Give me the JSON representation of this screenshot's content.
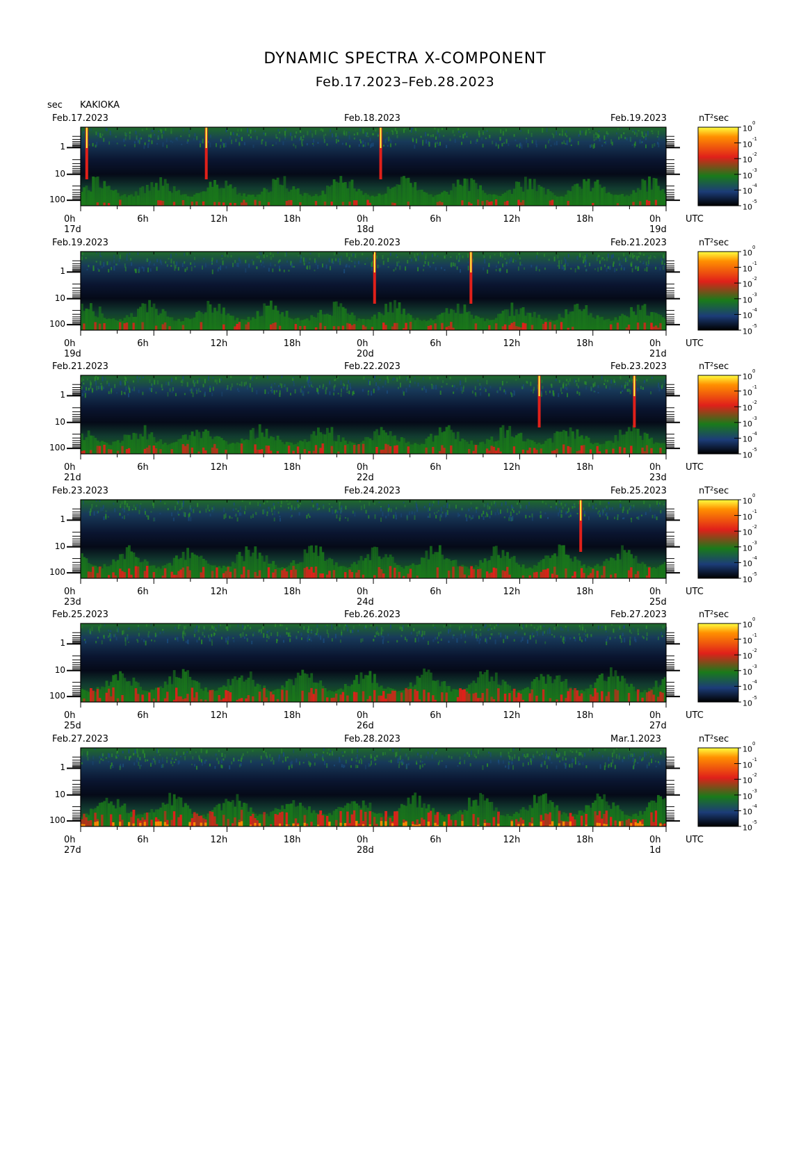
{
  "title": "DYNAMIC SPECTRA X-COMPONENT",
  "subtitle": "Feb.17.2023–Feb.28.2023",
  "y_unit": "sec",
  "station": "KAKIOKA",
  "colorbar_unit": "nT²sec",
  "colors": {
    "black": "#000000",
    "navy": "#0a1a4a",
    "blue": "#1c3c78",
    "green": "#1a7a1a",
    "red": "#e0201a",
    "orange": "#ff9000",
    "yellow": "#ffff40"
  },
  "chart_data": [
    {
      "type": "heatmap",
      "date_left": "Feb.17.2023",
      "date_mid": "Feb.18.2023",
      "date_right": "Feb.19.2023",
      "x_ticks": [
        "0h",
        "6h",
        "12h",
        "18h",
        "0h",
        "6h",
        "12h",
        "18h",
        "0h"
      ],
      "x_day_labels": [
        "17d",
        "18d",
        "19d"
      ],
      "x_unit": "UTC",
      "y_ticks": [
        "1",
        "10",
        "100"
      ],
      "y_scale": "log",
      "colorbar_ticks": [
        "10^0",
        "10^-1",
        "10^-2",
        "10^-3",
        "10^-4",
        "10^-5"
      ],
      "spikes_hours": [
        0.5,
        10.3,
        24.6
      ]
    },
    {
      "type": "heatmap",
      "date_left": "Feb.19.2023",
      "date_mid": "Feb.20.2023",
      "date_right": "Feb.21.2023",
      "x_ticks": [
        "0h",
        "6h",
        "12h",
        "18h",
        "0h",
        "6h",
        "12h",
        "18h",
        "0h"
      ],
      "x_day_labels": [
        "19d",
        "20d",
        "21d"
      ],
      "x_unit": "UTC",
      "y_ticks": [
        "1",
        "10",
        "100"
      ],
      "y_scale": "log",
      "colorbar_ticks": [
        "10^0",
        "10^-1",
        "10^-2",
        "10^-3",
        "10^-4",
        "10^-5"
      ],
      "spikes_hours": [
        24.1,
        32.0
      ]
    },
    {
      "type": "heatmap",
      "date_left": "Feb.21.2023",
      "date_mid": "Feb.22.2023",
      "date_right": "Feb.23.2023",
      "x_ticks": [
        "0h",
        "6h",
        "12h",
        "18h",
        "0h",
        "6h",
        "12h",
        "18h",
        "0h"
      ],
      "x_day_labels": [
        "21d",
        "22d",
        "23d"
      ],
      "x_unit": "UTC",
      "y_ticks": [
        "1",
        "10",
        "100"
      ],
      "y_scale": "log",
      "colorbar_ticks": [
        "10^0",
        "10^-1",
        "10^-2",
        "10^-3",
        "10^-4",
        "10^-5"
      ],
      "spikes_hours": [
        37.6,
        45.4
      ]
    },
    {
      "type": "heatmap",
      "date_left": "Feb.23.2023",
      "date_mid": "Feb.24.2023",
      "date_right": "Feb.25.2023",
      "x_ticks": [
        "0h",
        "6h",
        "12h",
        "18h",
        "0h",
        "6h",
        "12h",
        "18h",
        "0h"
      ],
      "x_day_labels": [
        "23d",
        "24d",
        "25d"
      ],
      "x_unit": "UTC",
      "y_ticks": [
        "1",
        "10",
        "100"
      ],
      "y_scale": "log",
      "colorbar_ticks": [
        "10^0",
        "10^-1",
        "10^-2",
        "10^-3",
        "10^-4",
        "10^-5"
      ],
      "spikes_hours": [
        41.0
      ]
    },
    {
      "type": "heatmap",
      "date_left": "Feb.25.2023",
      "date_mid": "Feb.26.2023",
      "date_right": "Feb.27.2023",
      "x_ticks": [
        "0h",
        "6h",
        "12h",
        "18h",
        "0h",
        "6h",
        "12h",
        "18h",
        "0h"
      ],
      "x_day_labels": [
        "25d",
        "26d",
        "27d"
      ],
      "x_unit": "UTC",
      "y_ticks": [
        "1",
        "10",
        "100"
      ],
      "y_scale": "log",
      "colorbar_ticks": [
        "10^0",
        "10^-1",
        "10^-2",
        "10^-3",
        "10^-4",
        "10^-5"
      ],
      "spikes_hours": []
    },
    {
      "type": "heatmap",
      "date_left": "Feb.27.2023",
      "date_mid": "Feb.28.2023",
      "date_right": "Mar.1.2023",
      "x_ticks": [
        "0h",
        "6h",
        "12h",
        "18h",
        "0h",
        "6h",
        "12h",
        "18h",
        "0h"
      ],
      "x_day_labels": [
        "27d",
        "28d",
        "1d"
      ],
      "x_unit": "UTC",
      "y_ticks": [
        "1",
        "10",
        "100"
      ],
      "y_scale": "log",
      "colorbar_ticks": [
        "10^0",
        "10^-1",
        "10^-2",
        "10^-3",
        "10^-4",
        "10^-5"
      ],
      "spikes_hours": []
    }
  ]
}
